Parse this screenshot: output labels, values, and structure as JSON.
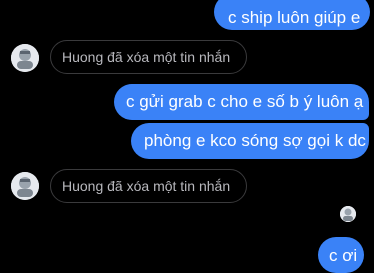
{
  "messages": {
    "m1": "c ship luôn giúp e",
    "deleted1": "Huong đã xóa một tin nhắn",
    "m2": "c gửi grab c cho e số b ý luôn ạ",
    "m3": "phòng e kco sóng sợ gọi k dc",
    "deleted2": "Huong đã xóa một tin nhắn",
    "m4": "c ơi"
  },
  "colors": {
    "outgoing_bubble": "#3a82f7",
    "background": "#000000",
    "deleted_border": "#3a3a3c"
  }
}
